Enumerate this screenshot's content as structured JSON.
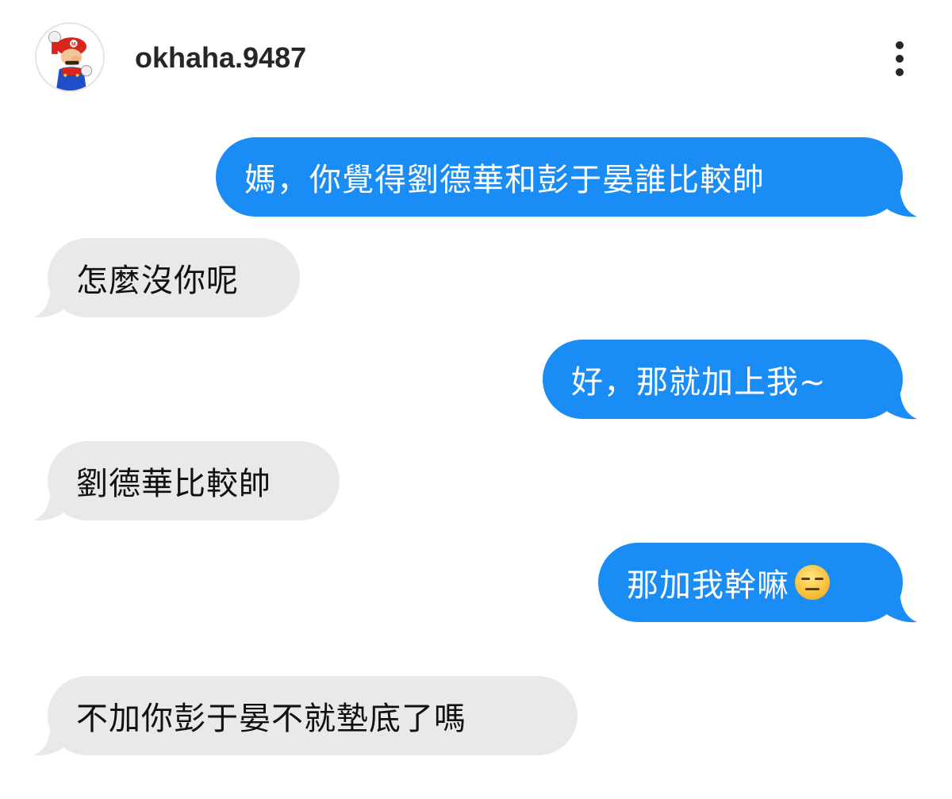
{
  "header": {
    "username": "okhaha.9487",
    "avatar_icon": "mario-avatar-icon",
    "more_icon": "more-vertical-icon"
  },
  "colors": {
    "sent_bubble": "#1a8cf5",
    "received_bubble": "#e9e9eb",
    "sent_text": "#ffffff",
    "received_text": "#111111"
  },
  "messages": [
    {
      "from": "me",
      "text": "媽，你覺得劉德華和彭于晏誰比較帥"
    },
    {
      "from": "other",
      "text": "怎麼沒你呢"
    },
    {
      "from": "me",
      "text": "好，那就加上我~"
    },
    {
      "from": "other",
      "text": "劉德華比較帥"
    },
    {
      "from": "me",
      "text": "那加我幹嘛",
      "emoji": "expressionless-face"
    },
    {
      "from": "other",
      "text": "不加你彭于晏不就墊底了嗎"
    }
  ]
}
